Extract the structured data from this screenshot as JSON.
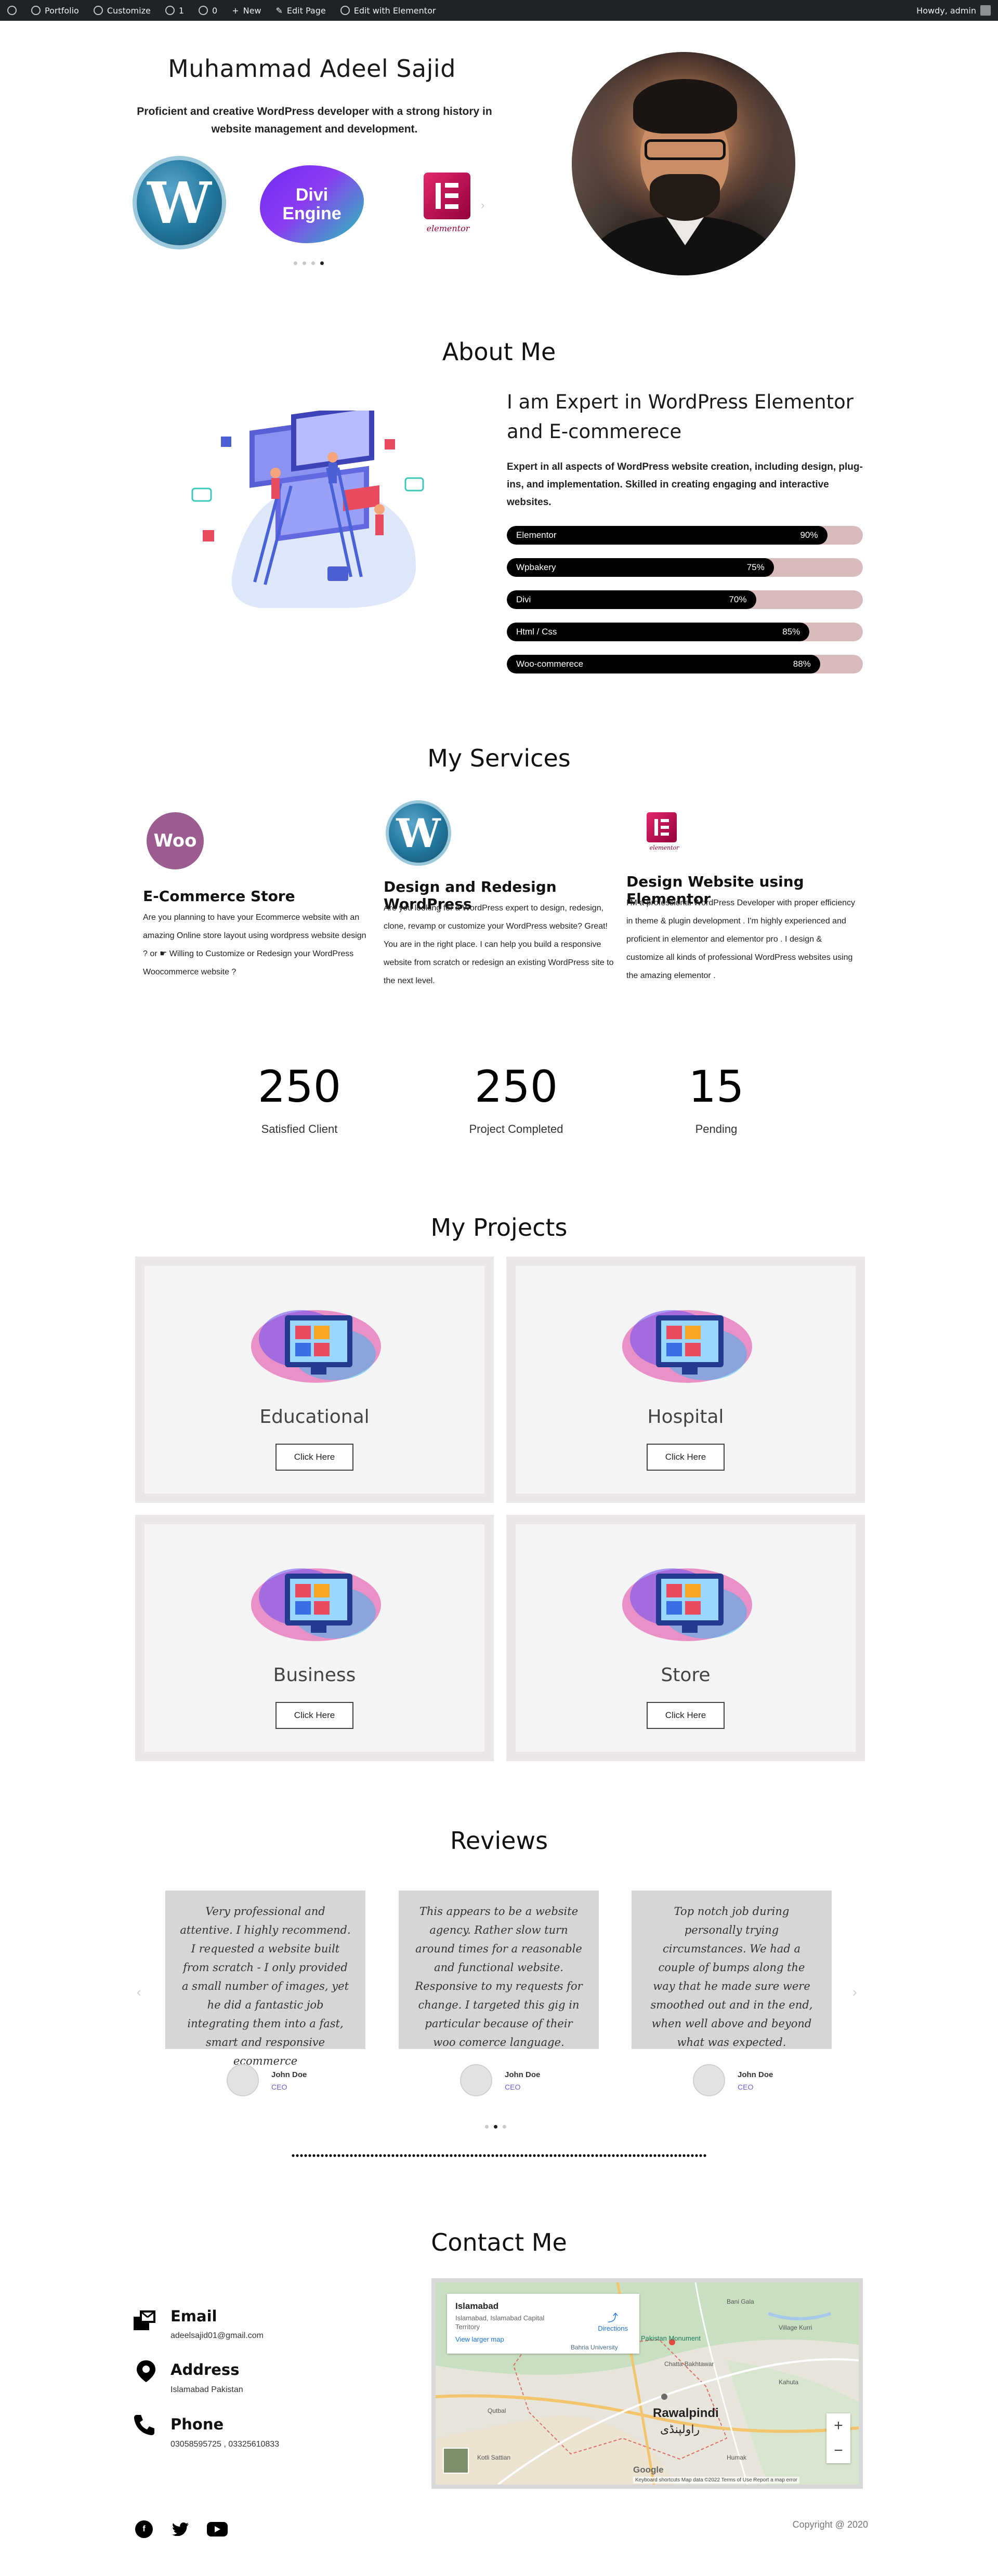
{
  "admin_bar": {
    "items": [
      "Portfolio",
      "Customize",
      "1",
      "0",
      "New",
      "Edit Page",
      "Edit with Elementor"
    ],
    "greeting": "Howdy, admin"
  },
  "hero": {
    "name": "Muhammad Adeel Sajid",
    "description": "Proficient and creative WordPress developer with a strong history in website management and development.",
    "logos": [
      "wordpress-logo",
      "divi-engine-logo",
      "elementor-logo"
    ],
    "divi_line1": "Divi",
    "divi_line2": "Engine",
    "elementor_text": "elementor",
    "slider_dots": 4,
    "active_dot": 4
  },
  "about": {
    "title": "About Me",
    "heading": "I am Expert in WordPress Elementor and E-commerece",
    "text": "Expert in all aspects of WordPress website creation, including design, plug-ins, and implementation. Skilled in creating engaging and interactive websites.",
    "skills": [
      {
        "name": "Elementor",
        "percent_label": "90%",
        "value": 90
      },
      {
        "name": "Wpbakery",
        "percent_label": "75%",
        "value": 75
      },
      {
        "name": "Divi",
        "percent_label": "70%",
        "value": 70
      },
      {
        "name": "Html / Css",
        "percent_label": "85%",
        "value": 85
      },
      {
        "name": "Woo-commerece",
        "percent_label": "88%",
        "value": 88
      }
    ]
  },
  "services": {
    "title": "My Services",
    "items": [
      {
        "icon": "woo",
        "title": "E-Commerce Store",
        "text": "Are you planning to have your Ecommerce website with an amazing Online store layout using wordpress website design ? or ☛ Willing to Customize or Redesign your WordPress Woocommerce website ?"
      },
      {
        "icon": "wordpress",
        "title": "Design and Redesign WordPress",
        "text": "Are you looking for a WordPress expert to design, redesign, clone, revamp or customize your WordPress website? Great! You are in the right place. I can help you build a responsive website from scratch or redesign an existing WordPress site to the next level."
      },
      {
        "icon": "elementor",
        "title": "Design Website using Elementor",
        "text": "I'M a professional WordPress Developer with proper efficiency in theme & plugin development . I'm highly experienced and proficient in elementor and elementor pro . I design & customize all kinds of professional WordPress websites using the amazing elementor ."
      }
    ],
    "woo_text": "Woo"
  },
  "counters": [
    {
      "number": "250",
      "label": "Satisfied Client"
    },
    {
      "number": "250",
      "label": "Project Completed"
    },
    {
      "number": "15",
      "label": "Pending"
    }
  ],
  "projects": {
    "title": "My Projects",
    "items": [
      {
        "name": "Educational",
        "button": "Click Here"
      },
      {
        "name": "Hospital",
        "button": "Click Here"
      },
      {
        "name": "Business",
        "button": "Click Here"
      },
      {
        "name": "Store",
        "button": "Click Here"
      }
    ]
  },
  "reviews": {
    "title": "Reviews",
    "items": [
      {
        "text": "Very professional and attentive. I highly recommend. I requested a website built from scratch - I only provided a small number of images, yet he did a fantastic job integrating them into a fast, smart and responsive ecommerce",
        "name": "John Doe",
        "role": "CEO"
      },
      {
        "text": "This appears to be a website agency. Rather slow turn around times for a reasonable and functional website. Responsive to my requests for change. I targeted this gig in particular because of their woo comerce language.",
        "name": "John Doe",
        "role": "CEO"
      },
      {
        "text": "Top notch job during personally trying circumstances. We had a couple of bumps along the way that he made sure were smoothed out and in the end, when well above and beyond what was expected.",
        "name": "John Doe",
        "role": "CEO"
      }
    ],
    "dots": 3,
    "active_dot": 2
  },
  "contact": {
    "title": "Contact Me",
    "email_label": "Email",
    "email": "adeelsajid01@gmail.com",
    "address_label": "Address",
    "address": "Islamabad Pakistan",
    "phone_label": "Phone",
    "phone": "03058595725 , 03325610833",
    "map": {
      "place": "Islamabad",
      "subtitle": "Islamabad, Islamabad Capital Territory",
      "larger_map": "View larger map",
      "directions": "Directions",
      "city": "Rawalpindi",
      "city_urdu": "راولپنڈی",
      "footer": "Keyboard shortcuts   Map data ©2022   Terms of Use   Report a map error",
      "google": "Google",
      "labels": [
        "Pakistan Monument",
        "Bahria University",
        "Bani Gala",
        "Village Kurri",
        "Chatta Bakhtawar",
        "Kahuta",
        "Humak",
        "Qutbal",
        "Kotli Sattian"
      ]
    },
    "social": [
      "facebook",
      "twitter",
      "youtube"
    ],
    "copyright": "Copyright @ 2020"
  }
}
